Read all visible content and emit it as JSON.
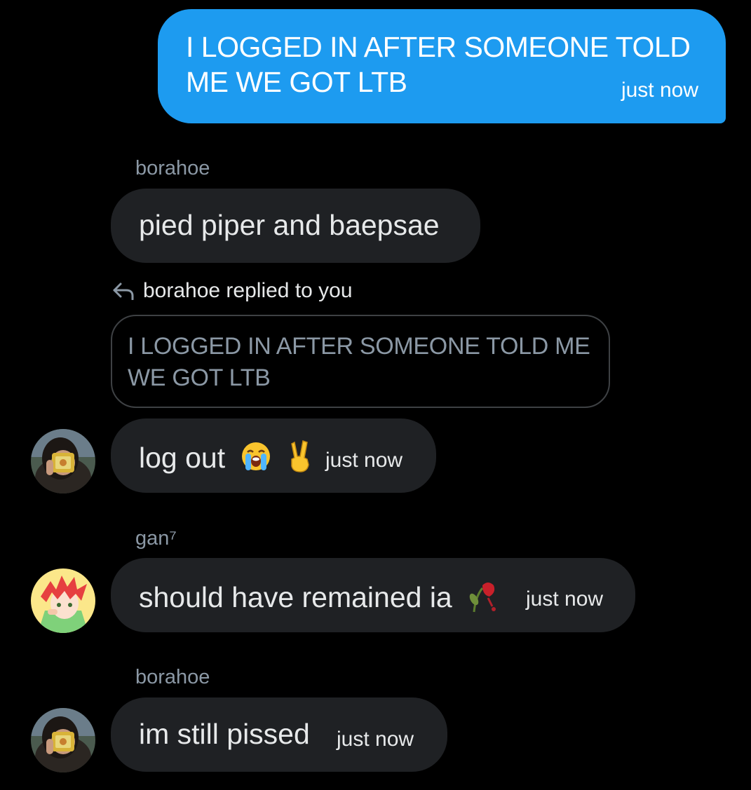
{
  "messages": [
    {
      "direction": "outgoing",
      "text": "I LOGGED IN AFTER SOMEONE TOLD ME WE GOT LTB",
      "time": "just now"
    },
    {
      "direction": "incoming",
      "sender": "borahoe",
      "text": "pied piper and baepsae"
    },
    {
      "direction": "incoming",
      "reply_label": "borahoe replied to you",
      "quoted_text": "I LOGGED IN AFTER SOMEONE TOLD ME WE GOT LTB",
      "text": "log out",
      "emojis": [
        "loudly-crying-face-emoji",
        "victory-hand-emoji"
      ],
      "time": "just now"
    },
    {
      "direction": "incoming",
      "sender": "gan⁷",
      "text": "should have remained ia",
      "emojis": [
        "wilted-flower-emoji"
      ],
      "time": "just now"
    },
    {
      "direction": "incoming",
      "sender": "borahoe",
      "text": "im still pissed",
      "time": "just now"
    }
  ],
  "colors": {
    "background": "#000000",
    "outgoing_bubble": "#1d9bf0",
    "incoming_bubble": "#1f2124",
    "secondary_text": "#8b98a5",
    "primary_text": "#e7e9ea"
  }
}
